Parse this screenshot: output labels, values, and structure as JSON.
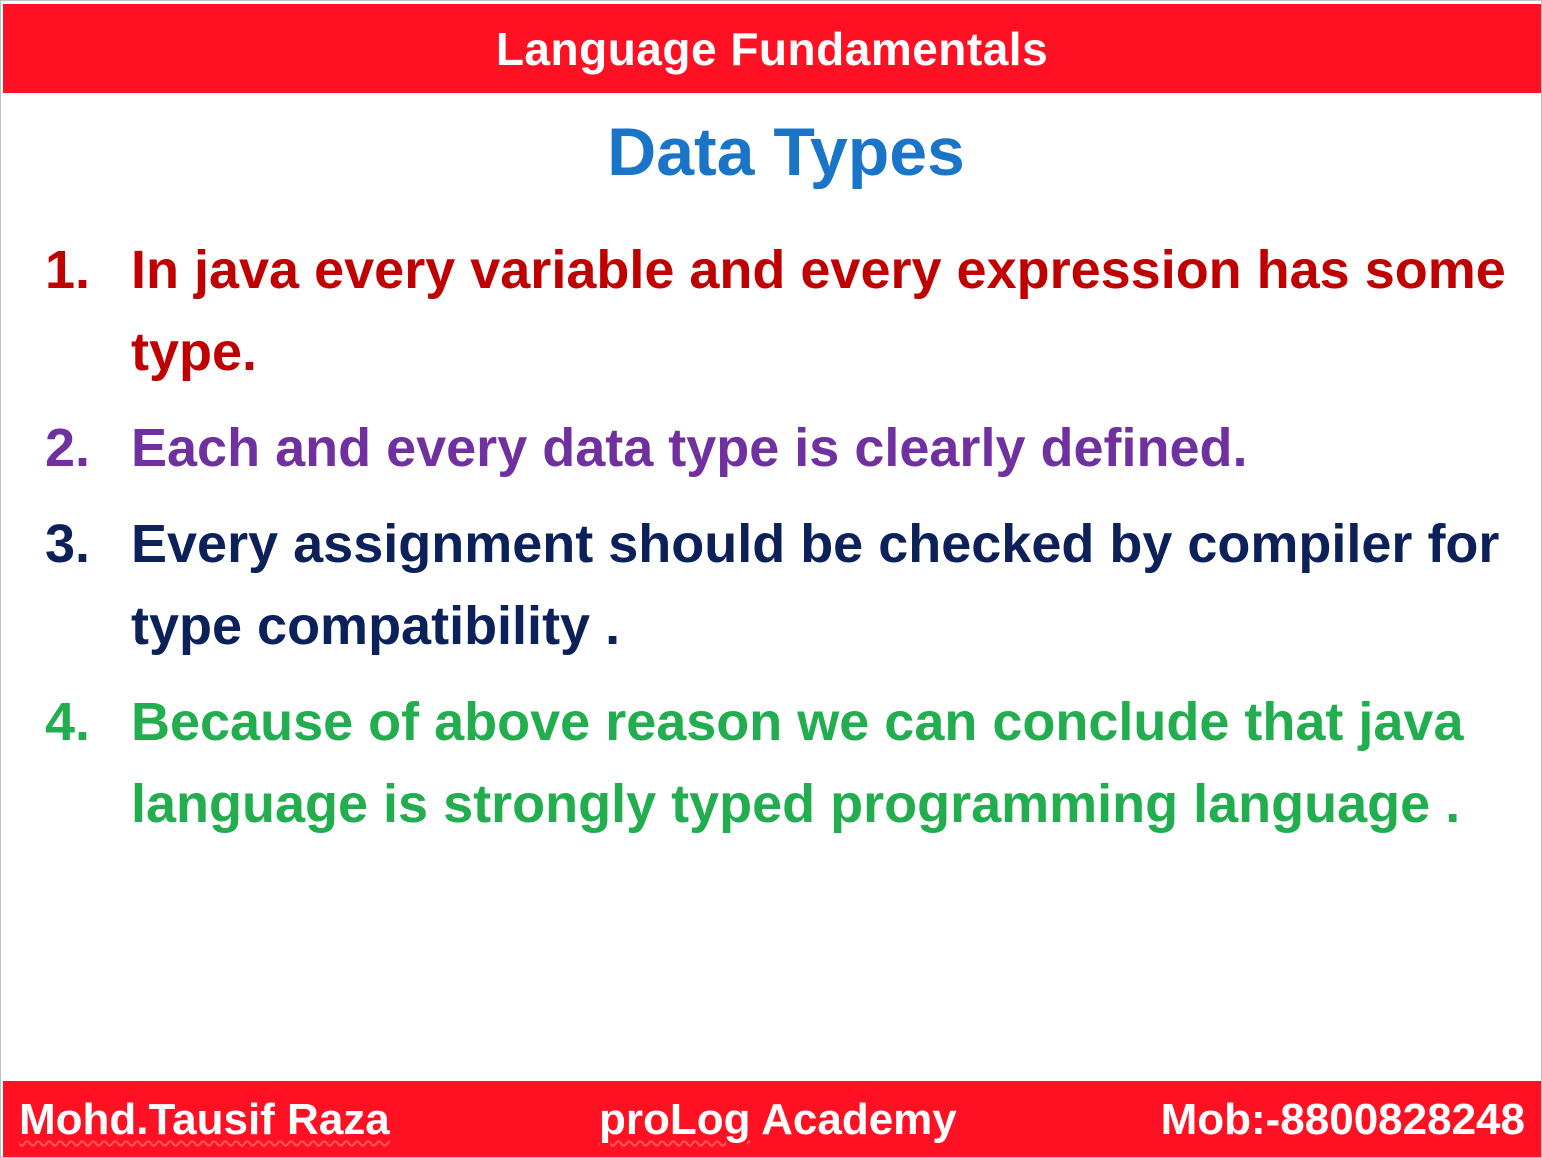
{
  "header": {
    "title": "Language Fundamentals"
  },
  "slide": {
    "title": "Data Types",
    "points": [
      {
        "number": "1.",
        "text": "In java every variable and every expression has some type.",
        "color": "#c00000"
      },
      {
        "number": "2.",
        "text": "Each and every data type is clearly defined.",
        "color": "#7030a0"
      },
      {
        "number": "3.",
        "text": "Every assignment should be checked by compiler for type compatibility .",
        "color": "#0c2059"
      },
      {
        "number": "4.",
        "text": "Because of above reason we can conclude that java language is strongly typed programming language .",
        "color": "#22ad4f"
      }
    ]
  },
  "footer": {
    "author": "Mohd.Tausif Raza",
    "academy_prefix": "proLog",
    "academy_suffix": " Academy",
    "phone": "Mob:-8800828248"
  },
  "colors": {
    "bar": "#ff1022",
    "title": "#1a74c7"
  }
}
